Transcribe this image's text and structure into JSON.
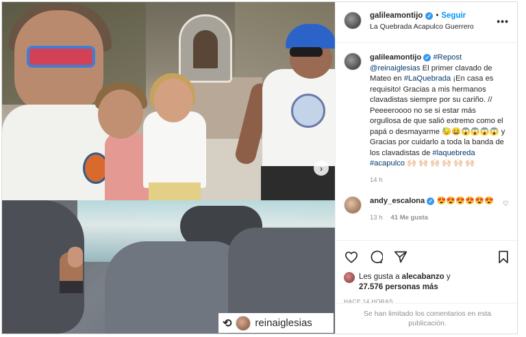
{
  "header": {
    "username": "galileamontijo",
    "follow_label": "Seguir",
    "location": "La Quebrada Acapulco Guerrero",
    "more_label": "•••"
  },
  "media": {
    "carousel_next": "›",
    "repost_username": "reinaiglesias"
  },
  "caption": {
    "username": "galileamontijo",
    "hashtag_repost": "#Repost",
    "mention": "@reinaiglesias",
    "text_1": "El primer clavado de Mateo en",
    "hashtag_1": "#LaQuebrada",
    "text_2": "¡En casa es requisito! Gracias a mis hermanos clavadistas siempre por su cariño. // Peeeeroooo no se si estar más orgullosa de que salió extremo como el papá o desmayarme 😓😄😱😱😱😱 y Gracias por cuidarlo a toda la banda de los clavadistas de",
    "hashtag_2": "#laquebreda",
    "hashtag_3": "#acapulco",
    "emoji_tail": "🙌🏻 🙌🏻 🙌🏻 🙌🏻 🙌🏻 🙌🏻",
    "time": "14 h"
  },
  "comment": {
    "username": "andy_escalona",
    "text": "😍😍😍😍😍😍",
    "time": "13 h",
    "likes": "41 Me gusta"
  },
  "actions": {
    "likes_prefix": "Les gusta a",
    "likes_user": "alecabanzo",
    "likes_and": "y",
    "likes_count": "27.576 personas más",
    "timestamp": "HACE 14 HORAS"
  },
  "footer": {
    "limited_text": "Se han limitado los comentarios en esta publicación."
  },
  "colors": {
    "link": "#00376b",
    "follow": "#0095f6",
    "verified": "#3897f0",
    "muted": "#8e8e8e"
  }
}
